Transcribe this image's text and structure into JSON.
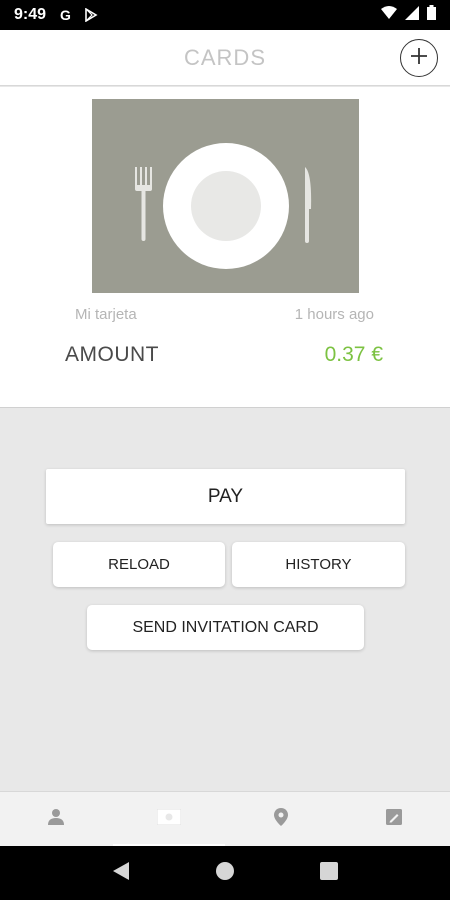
{
  "status_bar": {
    "time": "9:49",
    "icons": [
      "google-g-icon",
      "play-store-icon",
      "wifi-icon",
      "signal-icon",
      "battery-icon"
    ]
  },
  "app_bar": {
    "title": "CARDS",
    "add_icon": "plus-circle-icon"
  },
  "card": {
    "name": "Mi tarjeta",
    "updated": "1 hours ago",
    "amount_label": "AMOUNT",
    "amount_value": "0.37 €",
    "image_bg_color": "#9b9c91",
    "amount_color": "#7cc242"
  },
  "actions": {
    "pay_label": "PAY",
    "reload_label": "RELOAD",
    "history_label": "HISTORY",
    "invite_label": "SEND INVITATION CARD"
  },
  "bottom_nav": {
    "items": [
      {
        "icon": "person-icon"
      },
      {
        "icon": "card-icon",
        "active": true
      },
      {
        "icon": "location-pin-icon"
      },
      {
        "icon": "notes-icon"
      }
    ]
  },
  "system_nav": {
    "icons": [
      "back-icon",
      "home-icon",
      "recents-icon"
    ]
  }
}
